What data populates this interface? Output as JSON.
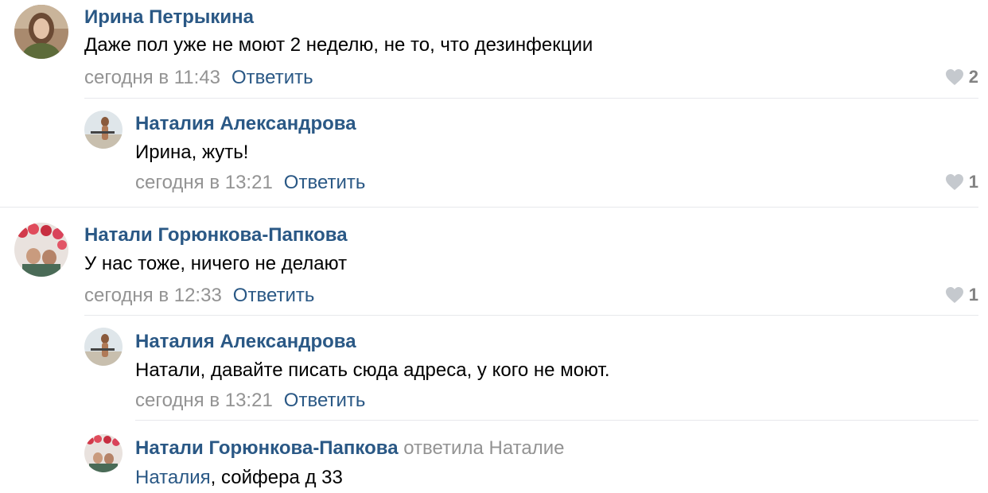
{
  "comments": [
    {
      "author": "Ирина Петрыкина",
      "text": "Даже пол уже не моют 2 неделю, не то, что дезинфекции",
      "time": "сегодня в 11:43",
      "reply_label": "Ответить",
      "likes": "2",
      "avatar_icon": "user-photo"
    },
    {
      "author": "Наталия Александрова",
      "text": "Ирина, жуть!",
      "time": "сегодня в 13:21",
      "reply_label": "Ответить",
      "likes": "1",
      "avatar_icon": "user-photo"
    },
    {
      "author": "Натали Горюнкова-Папкова",
      "text": "У нас тоже, ничего не делают",
      "time": "сегодня в 12:33",
      "reply_label": "Ответить",
      "likes": "1",
      "avatar_icon": "user-photo"
    },
    {
      "author": "Наталия Александрова",
      "text": "Натали, давайте писать сюда адреса, у кого не моют.",
      "time": "сегодня в 13:21",
      "reply_label": "Ответить",
      "avatar_icon": "user-photo"
    },
    {
      "author": "Натали Горюнкова-Папкова",
      "replied_to": "ответила Наталие",
      "mention": "Наталия",
      "text": ", сойфера д 33",
      "avatar_icon": "user-photo"
    }
  ],
  "colors": {
    "link": "#2a5885",
    "meta": "#939393",
    "divider": "#e7e8ec",
    "heart": "#c5c9ce"
  }
}
